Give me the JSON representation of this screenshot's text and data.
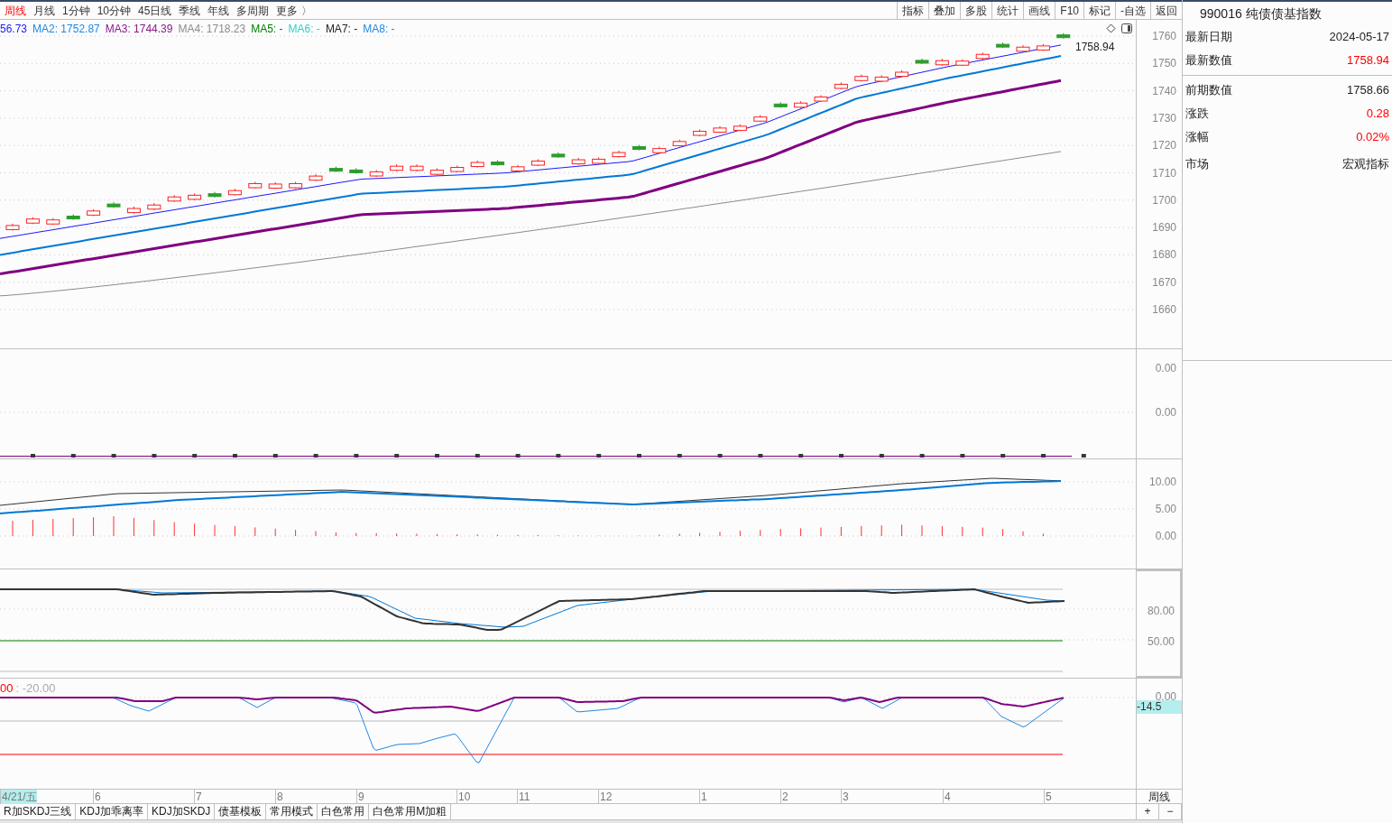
{
  "toolbar": {
    "periods": [
      {
        "label": "周线",
        "selected": true
      },
      {
        "label": "月线",
        "selected": false
      },
      {
        "label": "1分钟",
        "selected": false
      },
      {
        "label": "10分钟",
        "selected": false
      },
      {
        "label": "45日线",
        "selected": false
      },
      {
        "label": "季线",
        "selected": false
      },
      {
        "label": "年线",
        "selected": false
      },
      {
        "label": "多周期",
        "selected": false
      },
      {
        "label": "更多 〉",
        "selected": false
      }
    ],
    "buttons": [
      "指标",
      "叠加",
      "多股",
      "统计",
      "画线",
      "F10",
      "标记",
      "-自选",
      "返回"
    ]
  },
  "legend": [
    {
      "text": "56.73",
      "color": "#1a1aff"
    },
    {
      "text": "MA2: 1752.87",
      "color": "#1e88e5"
    },
    {
      "text": "MA3: 1744.39",
      "color": "#8b1a8b"
    },
    {
      "text": "MA4: 1718.23",
      "color": "#8c8c8c"
    },
    {
      "text": "MA5: -",
      "color": "#008000"
    },
    {
      "text": "MA6: -",
      "color": "#33cccc"
    },
    {
      "text": "MA7: -",
      "color": "#222222"
    },
    {
      "text": "MA8: -",
      "color": "#1e88e5"
    }
  ],
  "main_chart": {
    "last_price": "1758.94",
    "y_ticks": [
      "1760",
      "1750",
      "1740",
      "1730",
      "1720",
      "1710",
      "1700",
      "1690",
      "1680",
      "1670",
      "1660"
    ]
  },
  "panel_2": {
    "y_ticks": [
      "0.00",
      "0.00"
    ]
  },
  "panel_3": {
    "y_ticks": [
      "10.00",
      "5.00",
      "0.00"
    ]
  },
  "panel_4": {
    "y_ticks": [
      "80.00",
      "50.00"
    ]
  },
  "panel_5": {
    "legend": [
      {
        "text": "00",
        "color": "#ff0000"
      },
      {
        "text": ": -20.00",
        "color": "#aaaaaa"
      }
    ],
    "y_ticks": [
      "0.00"
    ],
    "current": "-14.5"
  },
  "x_axis": {
    "labels": [
      {
        "text": "4/21/五",
        "selected": true
      },
      {
        "text": "6",
        "selected": false
      },
      {
        "text": "7",
        "selected": false
      },
      {
        "text": "8",
        "selected": false
      },
      {
        "text": "9",
        "selected": false
      },
      {
        "text": "10",
        "selected": false
      },
      {
        "text": "11",
        "selected": false
      },
      {
        "text": "12",
        "selected": false
      },
      {
        "text": "1",
        "selected": false
      },
      {
        "text": "2",
        "selected": false
      },
      {
        "text": "3",
        "selected": false
      },
      {
        "text": "4",
        "selected": false
      },
      {
        "text": "5",
        "selected": false
      }
    ],
    "period": "周线"
  },
  "bottom_tabs": [
    "R加SKDJ三线",
    "KDJ加乖离率",
    "KDJ加SKDJ",
    "债基模板",
    "常用模式",
    "白色常用",
    "白色常用M加粗"
  ],
  "zoom_buttons": [
    "+",
    "−"
  ],
  "info_panel": {
    "title": "990016 纯债债基指数",
    "groups": [
      [
        {
          "label": "最新日期",
          "value": "2024-05-17",
          "color": "#222222"
        },
        {
          "label": "最新数值",
          "value": "1758.94",
          "color": "#ff0000"
        }
      ],
      [
        {
          "label": "前期数值",
          "value": "1758.66",
          "color": "#222222"
        },
        {
          "label": "涨跌",
          "value": "0.28",
          "color": "#ff0000"
        },
        {
          "label": "涨幅",
          "value": "0.02%",
          "color": "#ff0000"
        },
        {
          "label": "市场",
          "value": "宏观指标",
          "color": "#222222"
        }
      ]
    ]
  }
}
